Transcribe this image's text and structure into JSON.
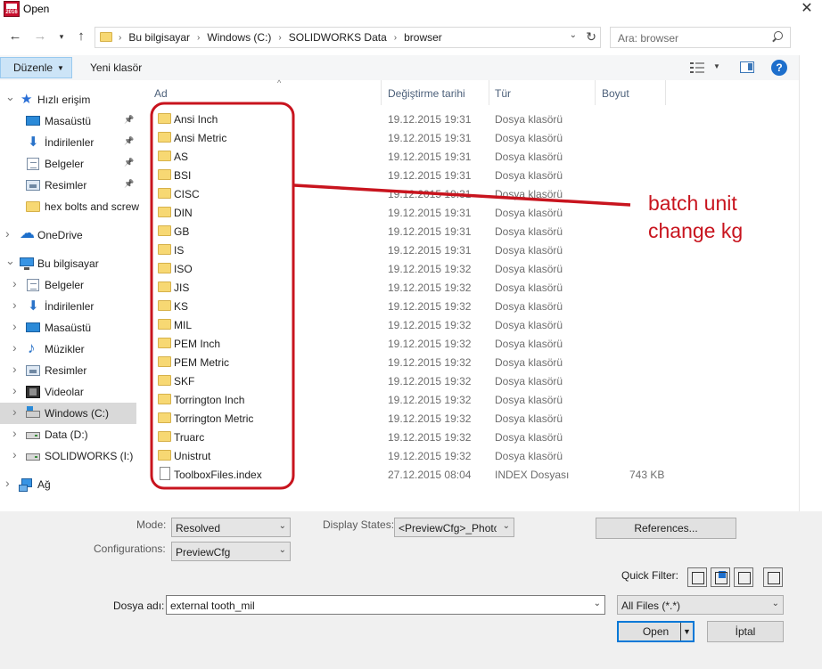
{
  "window": {
    "title": "Open",
    "app_icon_text": "2016"
  },
  "address": {
    "breadcrumbs": [
      "Bu bilgisayar",
      "Windows (C:)",
      "SOLIDWORKS Data",
      "browser"
    ]
  },
  "search": {
    "placeholder": "Ara: browser"
  },
  "toolbar": {
    "organize_label": "Düzenle",
    "new_folder_label": "Yeni klasör"
  },
  "sidebar": {
    "items": [
      {
        "label": "Hızlı erişim",
        "icon": "star-icon"
      },
      {
        "label": "Masaüstü",
        "icon": "desktop-icon"
      },
      {
        "label": "İndirilenler",
        "icon": "downloads-icon"
      },
      {
        "label": "Belgeler",
        "icon": "documents-icon"
      },
      {
        "label": "Resimler",
        "icon": "pictures-icon"
      },
      {
        "label": "hex bolts and screw",
        "icon": "folder-icon"
      },
      {
        "label": "OneDrive",
        "icon": "cloud-icon"
      },
      {
        "label": "Bu bilgisayar",
        "icon": "computer-icon"
      },
      {
        "label": "Belgeler",
        "icon": "documents-icon"
      },
      {
        "label": "İndirilenler",
        "icon": "downloads-icon"
      },
      {
        "label": "Masaüstü",
        "icon": "desktop-icon"
      },
      {
        "label": "Müzikler",
        "icon": "music-icon"
      },
      {
        "label": "Resimler",
        "icon": "pictures-icon"
      },
      {
        "label": "Videolar",
        "icon": "video-icon"
      },
      {
        "label": "Windows (C:)",
        "icon": "windows-drive-icon"
      },
      {
        "label": "Data (D:)",
        "icon": "drive-icon"
      },
      {
        "label": "SOLIDWORKS (I:)",
        "icon": "drive-icon"
      },
      {
        "label": "Ağ",
        "icon": "network-icon"
      }
    ]
  },
  "columns": {
    "name": "Ad",
    "date": "Değiştirme tarihi",
    "type": "Tür",
    "size": "Boyut"
  },
  "files": [
    {
      "name": "Ansi Inch",
      "date": "19.12.2015 19:31",
      "type": "Dosya klasörü",
      "size": ""
    },
    {
      "name": "Ansi Metric",
      "date": "19.12.2015 19:31",
      "type": "Dosya klasörü",
      "size": ""
    },
    {
      "name": "AS",
      "date": "19.12.2015 19:31",
      "type": "Dosya klasörü",
      "size": ""
    },
    {
      "name": "BSI",
      "date": "19.12.2015 19:31",
      "type": "Dosya klasörü",
      "size": ""
    },
    {
      "name": "CISC",
      "date": "19.12.2015 19:31",
      "type": "Dosya klasörü",
      "size": ""
    },
    {
      "name": "DIN",
      "date": "19.12.2015 19:31",
      "type": "Dosya klasörü",
      "size": ""
    },
    {
      "name": "GB",
      "date": "19.12.2015 19:31",
      "type": "Dosya klasörü",
      "size": ""
    },
    {
      "name": "IS",
      "date": "19.12.2015 19:31",
      "type": "Dosya klasörü",
      "size": ""
    },
    {
      "name": "ISO",
      "date": "19.12.2015 19:32",
      "type": "Dosya klasörü",
      "size": ""
    },
    {
      "name": "JIS",
      "date": "19.12.2015 19:32",
      "type": "Dosya klasörü",
      "size": ""
    },
    {
      "name": "KS",
      "date": "19.12.2015 19:32",
      "type": "Dosya klasörü",
      "size": ""
    },
    {
      "name": "MIL",
      "date": "19.12.2015 19:32",
      "type": "Dosya klasörü",
      "size": ""
    },
    {
      "name": "PEM Inch",
      "date": "19.12.2015 19:32",
      "type": "Dosya klasörü",
      "size": ""
    },
    {
      "name": "PEM Metric",
      "date": "19.12.2015 19:32",
      "type": "Dosya klasörü",
      "size": ""
    },
    {
      "name": "SKF",
      "date": "19.12.2015 19:32",
      "type": "Dosya klasörü",
      "size": ""
    },
    {
      "name": "Torrington Inch",
      "date": "19.12.2015 19:32",
      "type": "Dosya klasörü",
      "size": ""
    },
    {
      "name": "Torrington Metric",
      "date": "19.12.2015 19:32",
      "type": "Dosya klasörü",
      "size": ""
    },
    {
      "name": "Truarc",
      "date": "19.12.2015 19:32",
      "type": "Dosya klasörü",
      "size": ""
    },
    {
      "name": "Unistrut",
      "date": "19.12.2015 19:32",
      "type": "Dosya klasörü",
      "size": ""
    },
    {
      "name": "ToolboxFiles.index",
      "date": "27.12.2015 08:04",
      "type": "INDEX Dosyası",
      "size": "743 KB",
      "is_file": true
    }
  ],
  "options": {
    "mode_label": "Mode:",
    "mode_value": "Resolved",
    "configurations_label": "Configurations:",
    "configurations_value": "PreviewCfg",
    "display_states_label": "Display States:",
    "display_states_value": "<PreviewCfg>_Photo",
    "references_label": "References...",
    "quick_filter_label": "Quick Filter:"
  },
  "filename": {
    "label": "Dosya adı:",
    "value": "external tooth_mil"
  },
  "filetype": {
    "value": "All Files (*.*)"
  },
  "actions": {
    "open_label": "Open",
    "cancel_label": "İptal"
  },
  "annotation": {
    "line1": "batch unit",
    "line2": "change kg",
    "color": "#c8141e"
  }
}
